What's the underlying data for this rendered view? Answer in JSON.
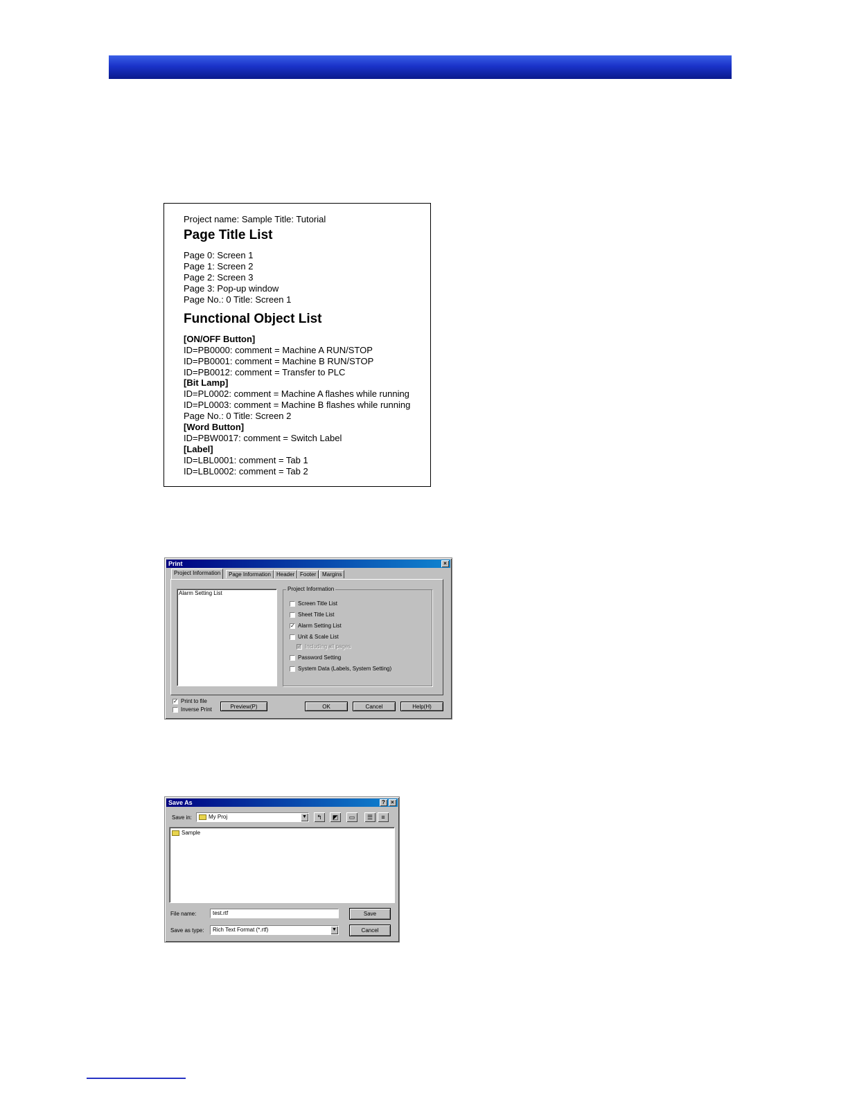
{
  "printout": {
    "project_line": "Project name: Sample   Title: Tutorial",
    "page_title_heading": "Page Title List",
    "pages": [
      "Page 0: Screen 1",
      "Page 1: Screen 2",
      "Page 2: Screen 3",
      "Page 3: Pop-up window",
      "Page No.: 0   Title: Screen 1"
    ],
    "functional_heading": "Functional Object List",
    "onoff_heading": "[ON/OFF Button]",
    "onoff_items": [
      "ID=PB0000: comment = Machine A RUN/STOP",
      "ID=PB0001: comment = Machine B RUN/STOP",
      "ID=PB0012: comment = Transfer to PLC"
    ],
    "bitlamp_heading": "[Bit Lamp]",
    "bitlamp_items": [
      "ID=PL0002: comment = Machine A flashes while running",
      "ID=PL0003: comment = Machine B flashes while running"
    ],
    "page2_line": "Page No.: 0   Title: Screen 2",
    "word_heading": "[Word Button]",
    "word_items": [
      "ID=PBW0017: comment = Switch Label"
    ],
    "label_heading": "[Label]",
    "label_items": [
      "ID=LBL0001: comment = Tab 1",
      "ID=LBL0002: comment = Tab 2"
    ]
  },
  "print_dialog": {
    "title": "Print",
    "close": "×",
    "tabs": [
      "Project Information",
      "Page Information",
      "Header",
      "Footer",
      "Margins"
    ],
    "list_item": "Alarm Setting List",
    "group_title": "Project Information",
    "options": [
      {
        "label": "Screen Title List",
        "checked": ""
      },
      {
        "label": "Sheet Title List",
        "checked": ""
      },
      {
        "label": "Alarm Setting List",
        "checked": "✓"
      },
      {
        "label": "Unit & Scale List",
        "checked": ""
      },
      {
        "label": "Including all pages",
        "checked": "✓"
      },
      {
        "label": "Password Setting",
        "checked": ""
      },
      {
        "label": "System Data (Labels, System Setting)",
        "checked": ""
      }
    ],
    "print_to_file": "Print to file",
    "print_to_file_checked": "✓",
    "inverse_print": "Inverse Print",
    "preview": "Preview(P)",
    "ok": "OK",
    "cancel": "Cancel",
    "help": "Help(H)"
  },
  "save_dialog": {
    "title": "Save As",
    "help_btn": "?",
    "close": "×",
    "save_in_label": "Save in:",
    "save_in_value": "My Proj",
    "folder_item": "Sample",
    "file_name_label": "File name:",
    "file_name_value": "test.rtf",
    "save_as_type_label": "Save as type:",
    "save_as_type_value": "Rich Text Format (*.rtf)",
    "save": "Save",
    "cancel": "Cancel"
  }
}
